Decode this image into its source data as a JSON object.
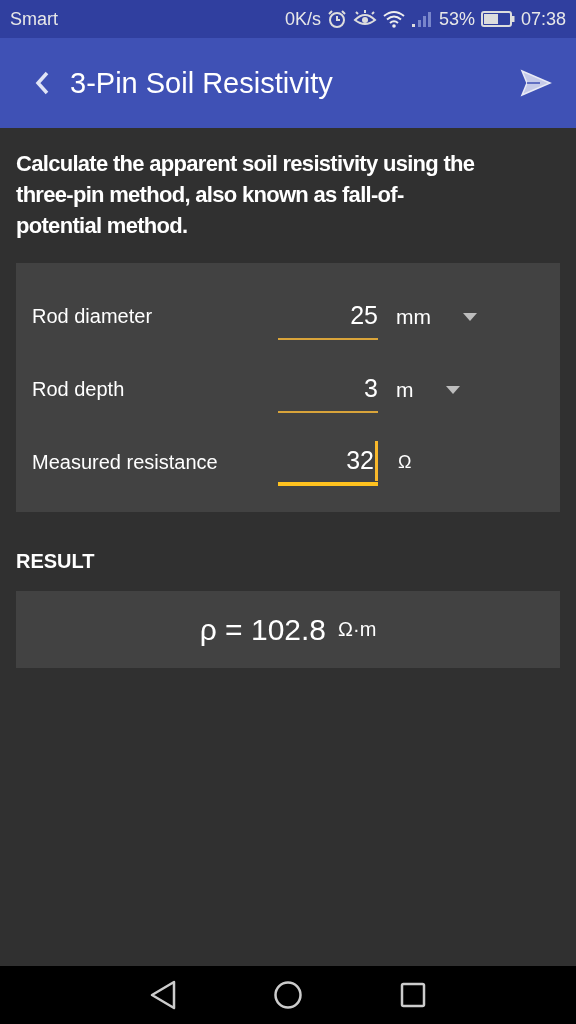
{
  "status_bar": {
    "carrier": "Smart",
    "speed": "0K/s",
    "battery": "53%",
    "time": "07:38"
  },
  "app_bar": {
    "title": "3-Pin Soil Resistivity"
  },
  "description": "Calculate the apparent soil resistivity using the three-pin method, also known as fall-of-potential method.",
  "fields": [
    {
      "label": "Rod diameter",
      "value": "25",
      "unit": "mm",
      "kind": "dropdown",
      "focused": false
    },
    {
      "label": "Rod depth",
      "value": "3",
      "unit": "m",
      "kind": "dropdown",
      "focused": false
    },
    {
      "label": "Measured resistance",
      "value": "32",
      "unit": "Ω",
      "kind": "fixed",
      "focused": true
    }
  ],
  "result": {
    "heading": "RESULT",
    "value": "ρ = 102.8",
    "unit": "Ω·m"
  }
}
